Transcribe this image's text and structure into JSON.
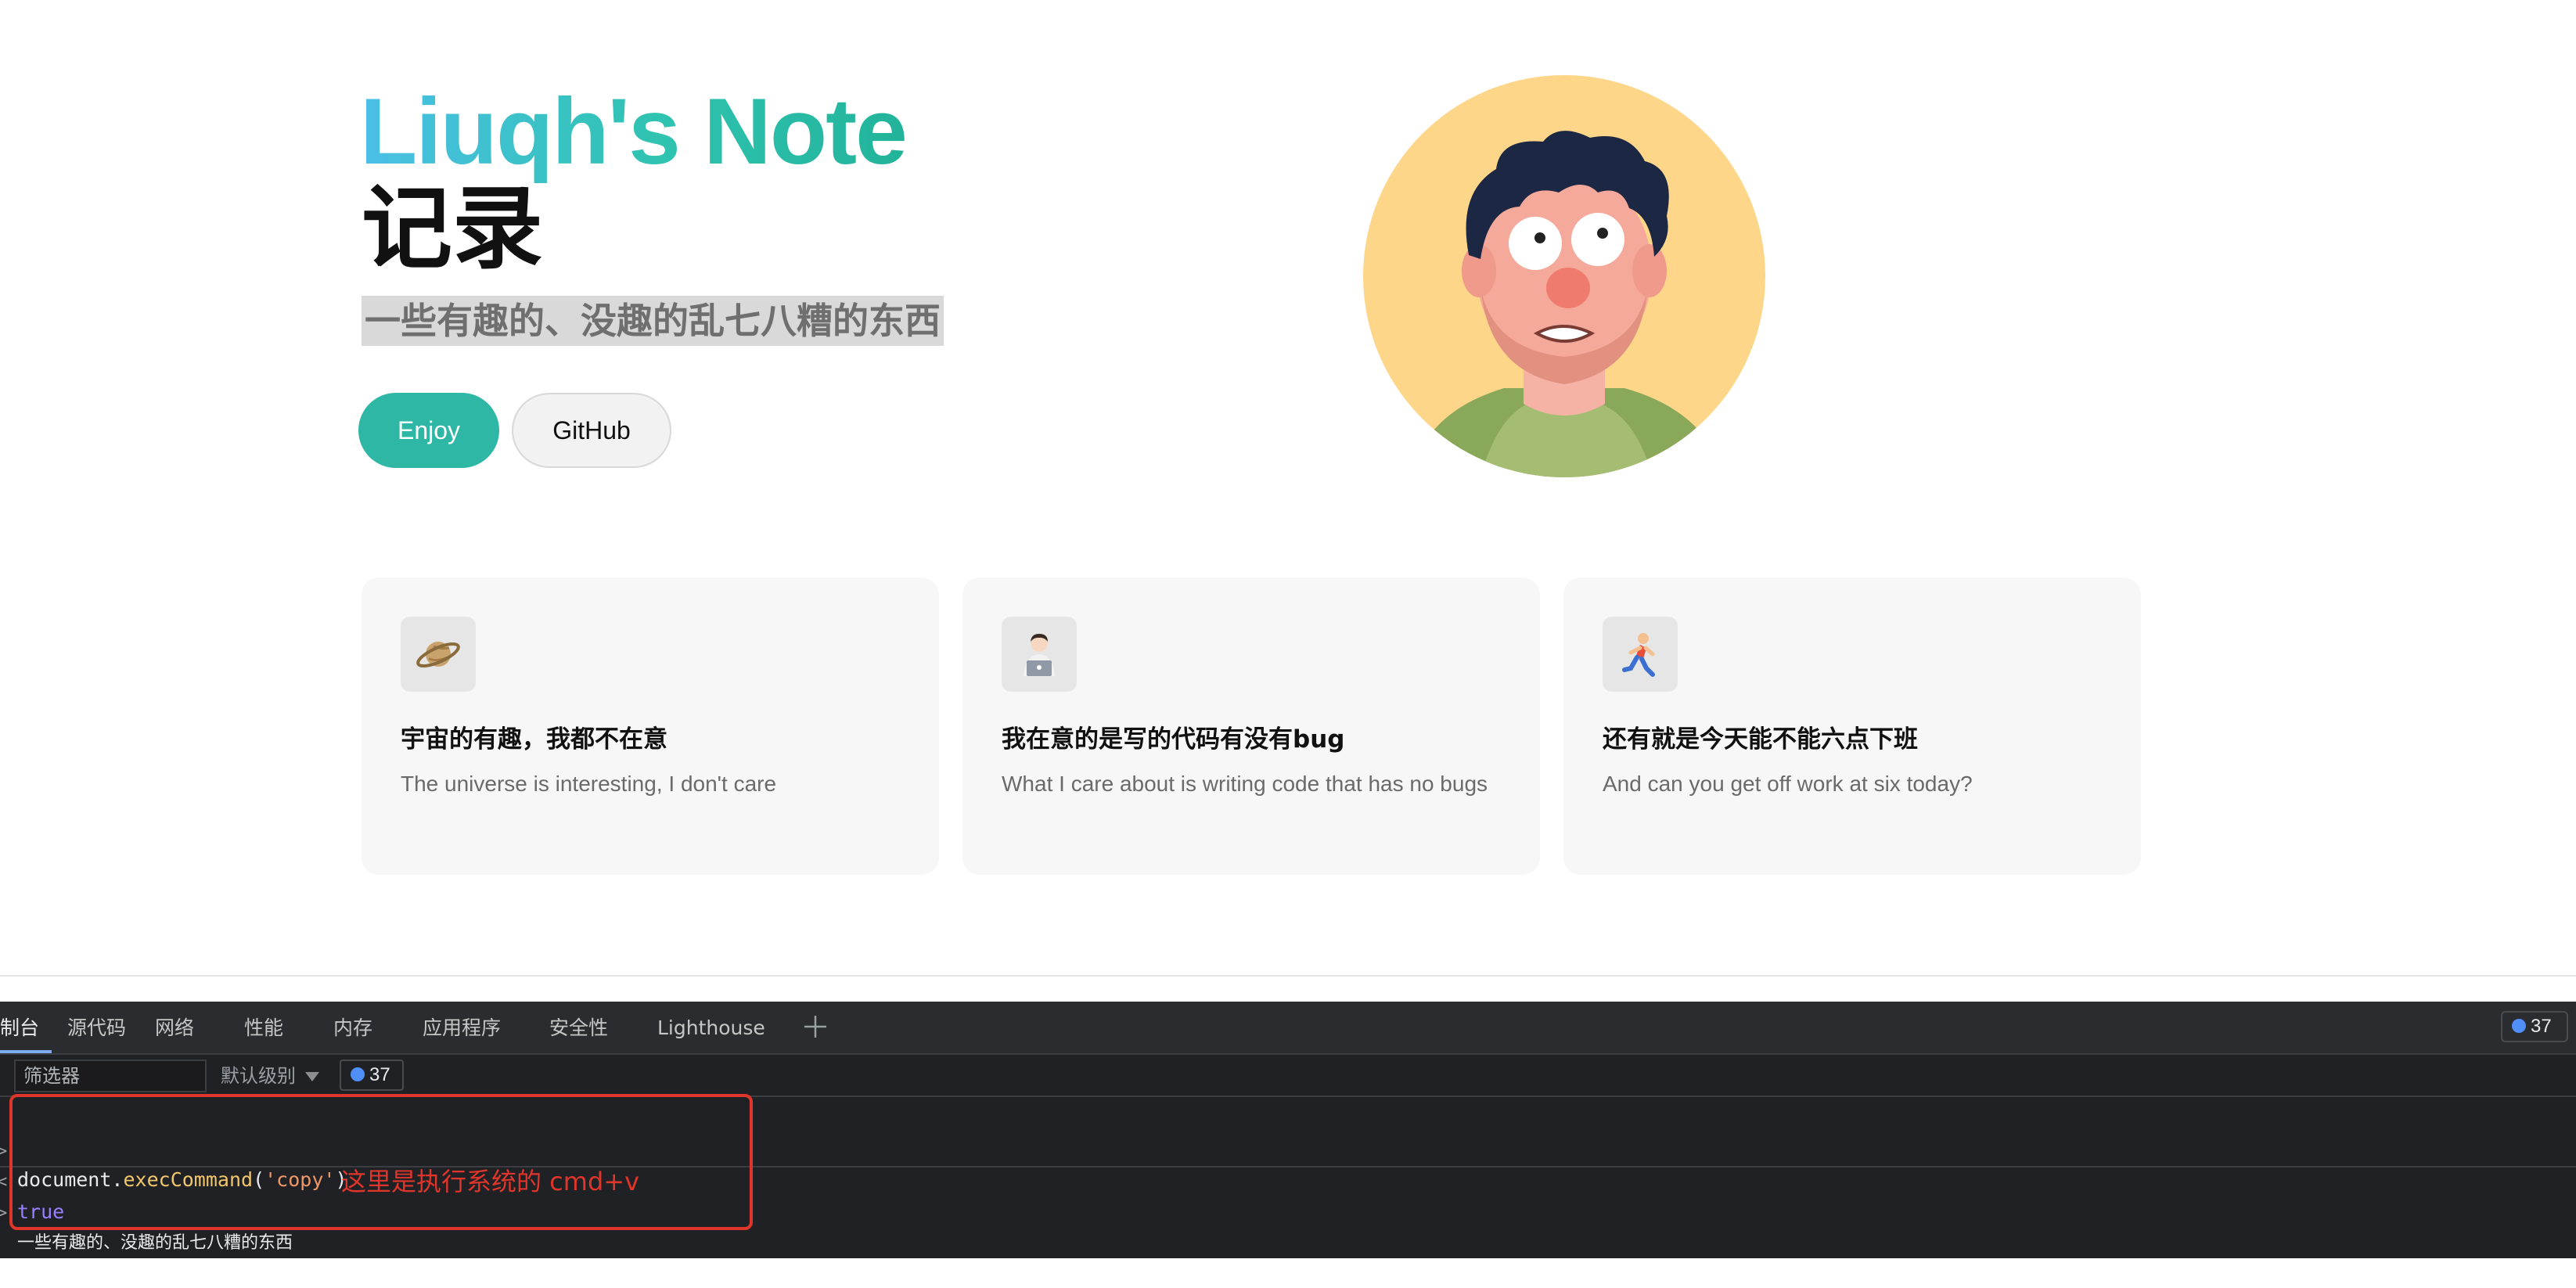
{
  "hero": {
    "brand": "Liuqh's Note",
    "title": "记录",
    "tagline": "一些有趣的、没趣的乱七八糟的东西",
    "buttons": {
      "enjoy": "Enjoy",
      "github": "GitHub"
    }
  },
  "features": [
    {
      "icon": "ringed-planet-icon",
      "title": "宇宙的有趣，我都不在意",
      "desc": "The universe is interesting, I don't care"
    },
    {
      "icon": "technologist-icon",
      "title": "我在意的是写的代码有没有bug",
      "desc": "What I care about is writing code that has no bugs"
    },
    {
      "icon": "running-person-icon",
      "title": "还有就是今天能不能六点下班",
      "desc": "And can you get off work at six today?"
    }
  ],
  "devtools": {
    "tabs": [
      "制台",
      "源代码",
      "网络",
      "性能",
      "内存",
      "应用程序",
      "安全性",
      "Lighthouse"
    ],
    "active_tab": "制台",
    "issues_count": "37",
    "filter_placeholder": "筛选器",
    "level": "默认级别",
    "console": {
      "input": {
        "obj": "document",
        "dot": ".",
        "fn": "execCommand",
        "open": "(",
        "arg": "'copy'",
        "close": ")"
      },
      "result": "true",
      "pasted": "一些有趣的、没趣的乱七八糟的东西"
    }
  },
  "annotation": "这里是执行系统的 cmd+v",
  "colors": {
    "brand_gradient_start": "#4bbfe6",
    "brand_gradient_end": "#22b39a",
    "primary_button": "#2db7a4",
    "annotation_red": "#e0352b"
  }
}
